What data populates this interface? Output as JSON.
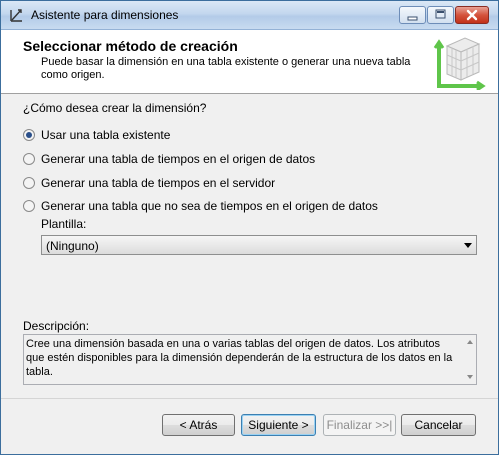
{
  "window": {
    "title": "Asistente para dimensiones",
    "icon": "dimension-wizard-icon",
    "controls": [
      "minimize-icon",
      "maximize-icon",
      "close-icon"
    ]
  },
  "header": {
    "title": "Seleccionar método de creación",
    "description": "Puede basar la dimensión en una tabla existente o generar una nueva tabla como origen.",
    "icon": "table-cube-icon"
  },
  "question": "¿Cómo desea crear la dimensión?",
  "options": [
    {
      "label": "Usar una tabla existente",
      "checked": true
    },
    {
      "label": "Generar una tabla de tiempos en el origen de datos",
      "checked": false
    },
    {
      "label": "Generar una tabla de tiempos en el servidor",
      "checked": false
    },
    {
      "label": "Generar una tabla que no sea de tiempos en el origen de datos",
      "checked": false
    }
  ],
  "template": {
    "label": "Plantilla:",
    "value": "(Ninguno)"
  },
  "description": {
    "label": "Descripción:",
    "text": "Cree una dimensión basada en una o varias tablas del origen de datos. Los atributos que estén disponibles para la dimensión dependerán de la estructura de los datos en la tabla."
  },
  "buttons": {
    "back": "< Atrás",
    "next": "Siguiente >",
    "finish": "Finalizar >>|",
    "cancel": "Cancelar"
  }
}
